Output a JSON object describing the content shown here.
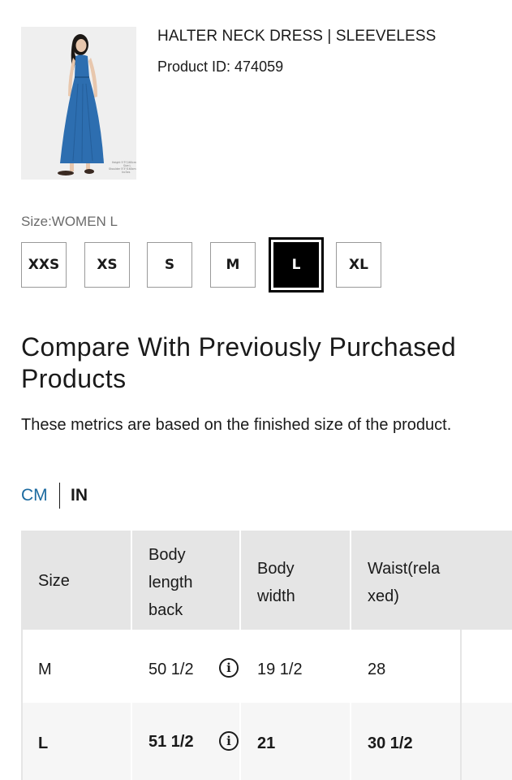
{
  "product": {
    "title": "HALTER NECK DRESS | SLEEVELESS",
    "id_text": "Product ID: 474059",
    "image_caption_lines": [
      "Height 5'3\"/160cm",
      "Size L",
      "Shoulder 5'3\"/160cm",
      "Inches"
    ]
  },
  "size": {
    "label": "Size:WOMEN L",
    "options": [
      "XXS",
      "XS",
      "S",
      "M",
      "L",
      "XL"
    ],
    "selected": "L"
  },
  "compare": {
    "title": "Compare With Previously Purchased Products",
    "description": "These metrics are based on the finished size of the product.",
    "units": {
      "cm": "CM",
      "in": "IN",
      "selected": "IN"
    }
  },
  "table": {
    "headers": {
      "size": "Size",
      "body_length_back": [
        "Body",
        "length",
        "back"
      ],
      "body_width": [
        "Body",
        "width"
      ],
      "waist": [
        "Waist(rela",
        "xed)"
      ]
    },
    "rows": [
      {
        "size": "M",
        "body_length_back": "50 1/2",
        "body_width": "19 1/2",
        "waist": "28",
        "highlighted": false
      },
      {
        "size": "L",
        "body_length_back": "51 1/2",
        "body_width": "21",
        "waist": "30 1/2",
        "highlighted": true
      }
    ]
  },
  "colors": {
    "accent_link": "#1b6aa0",
    "header_bg": "#e5e5e5",
    "highlight_row_bg": "#f6f6f6",
    "dress": "#2d6eb0"
  },
  "icons": {
    "info": "info-icon"
  }
}
